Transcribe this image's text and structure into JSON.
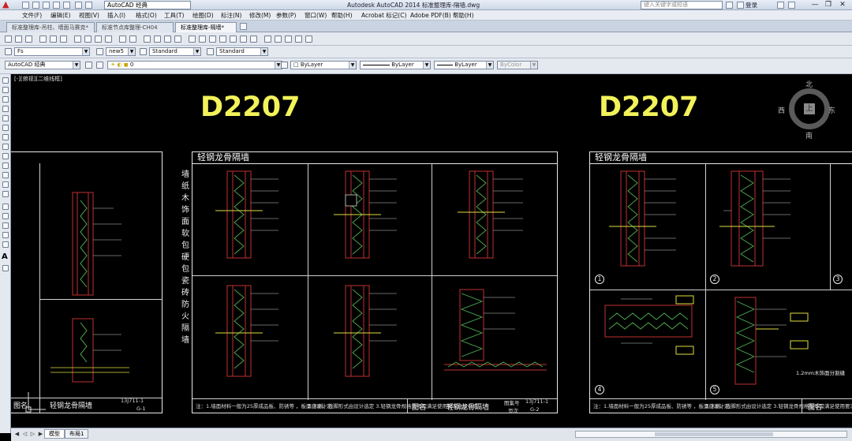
{
  "titlebar": {
    "workspace": "AutoCAD 经典",
    "app_title": "Autodesk AutoCAD 2014    标准整理库-隔墙.dwg",
    "search_placeholder": "键入关键字或短语",
    "login": "登录",
    "minimize": "—",
    "restore": "❐",
    "close": "✕"
  },
  "menu": [
    "文件(F)",
    "编辑(E)",
    "视图(V)",
    "插入(I)",
    "格式(O)",
    "工具(T)",
    "绘图(D)",
    "标注(N)",
    "修改(M)",
    "参数(P)",
    "窗口(W)",
    "帮助(H)",
    "Acrobat 标记(C)",
    "Adobe PDF(B)",
    "帮助(H)"
  ],
  "tabs": [
    {
      "label": "标准整理库-吊柱、墙面马赛克*",
      "active": false
    },
    {
      "label": "标准节点库整理-CH04",
      "active": false
    },
    {
      "label": "标准整理库-隔墙*",
      "active": true
    }
  ],
  "toolbar_styles": {
    "text_style": "Fs",
    "dim_style": "new5",
    "table_style": "Standard",
    "mleader_style": "Standard"
  },
  "toolbar_layers": {
    "workspace": "AutoCAD 经典",
    "layer": "0",
    "color": "ByLayer",
    "linetype": "ByLayer",
    "lineweight": "ByLayer",
    "plotstyle": "ByColor"
  },
  "drawing": {
    "viewport_label": "[-][俯视][二维线框]",
    "left_sheet": {
      "title": "D2207",
      "frame_header": "轻钢龙骨隔墙",
      "vertical_caption": "墙纸木饰面软包硬包瓷砖防火隔墙",
      "note_left": "注：1.墙面材料一般为25厚成品板、防锈等 ，板面应设计定",
      "note_right": "2.木料、线脚形式由设计选定  3.轻钢龙骨规格型号需满足使用要求由设计定",
      "footer_name_label": "图名",
      "footer_name": "轻钢龙骨隔墙",
      "footer_no_label": "图集号",
      "footer_no": "13J711-1",
      "footer_page_label": "页次",
      "footer_page": "G-2",
      "footer_left_name": "轻钢龙骨隔墙",
      "footer_left_no": "13J711-1",
      "footer_left_page": "G-1"
    },
    "right_sheet": {
      "title": "D2207",
      "frame_header": "轻钢龙骨隔墙",
      "detail_numbers": [
        "1",
        "2",
        "3",
        "4",
        "5"
      ],
      "note_left": "注：1.墙面材料一般为25厚成品板、防锈等 ，板面应设计定",
      "note_right": "2.木料、线脚形式由设计选定  3.轻钢龙骨规格型号需满足使用要求由设计定",
      "footer_name_label": "图名",
      "annotation": "1.2mm木饰面分割缝"
    },
    "viewcube": {
      "north": "北",
      "south": "南",
      "east": "东",
      "west": "西",
      "top": "上"
    }
  },
  "layout_tabs": [
    "模型",
    "布局1"
  ]
}
